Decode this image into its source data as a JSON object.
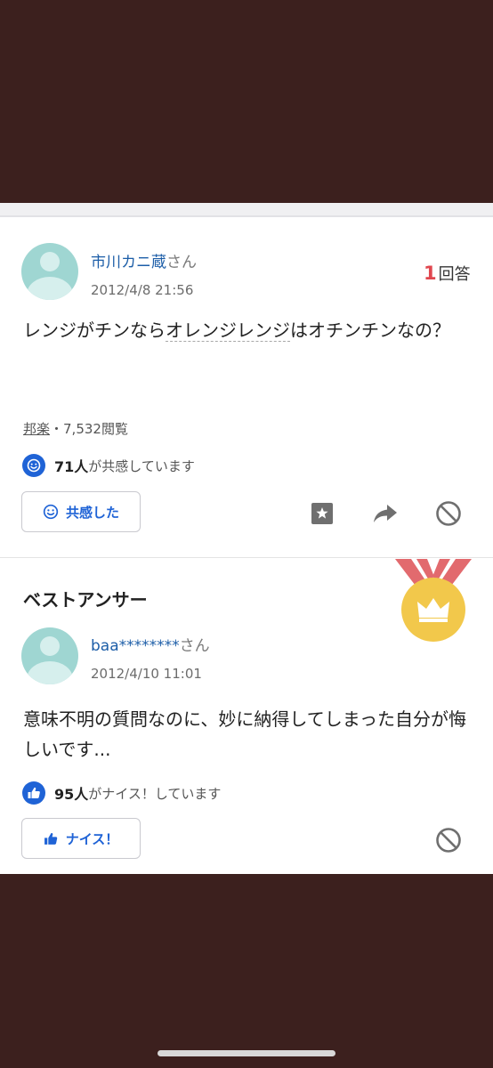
{
  "question": {
    "user_name": "市川カニ蔵",
    "user_suffix": "さん",
    "date": "2012/4/8 21:56",
    "answer_count": "1",
    "answer_count_label": "回答",
    "text_before": "レンジがチンなら",
    "text_dotted": "オレンジレンジ",
    "text_after": "はオチンチンなの？",
    "category": "邦楽",
    "views": "・7,532閲覧",
    "empathy_count": "71人",
    "empathy_text": "が共感しています",
    "empathy_button": "共感した",
    "icons": [
      "bookmark-icon",
      "share-icon",
      "block-icon"
    ]
  },
  "best_answer": {
    "heading": "ベストアンサー",
    "user_name": "baa********",
    "user_suffix": "さん",
    "date": "2012/4/10 11:01",
    "text": "意味不明の質問なのに、妙に納得してしまった自分が悔しいです...",
    "nice_count": "95人",
    "nice_text": "がナイス！しています",
    "nice_button": "ナイス！",
    "icons": [
      "medal-icon",
      "thumbs-up-icon",
      "block-icon"
    ]
  },
  "colors": {
    "background": "#3c201e",
    "link_blue": "#1d5ea8",
    "accent_blue": "#1f63d6",
    "answer_count_red": "#e0474f",
    "medal_gold": "#f2c84b",
    "ribbon_red": "#e26a6e"
  }
}
